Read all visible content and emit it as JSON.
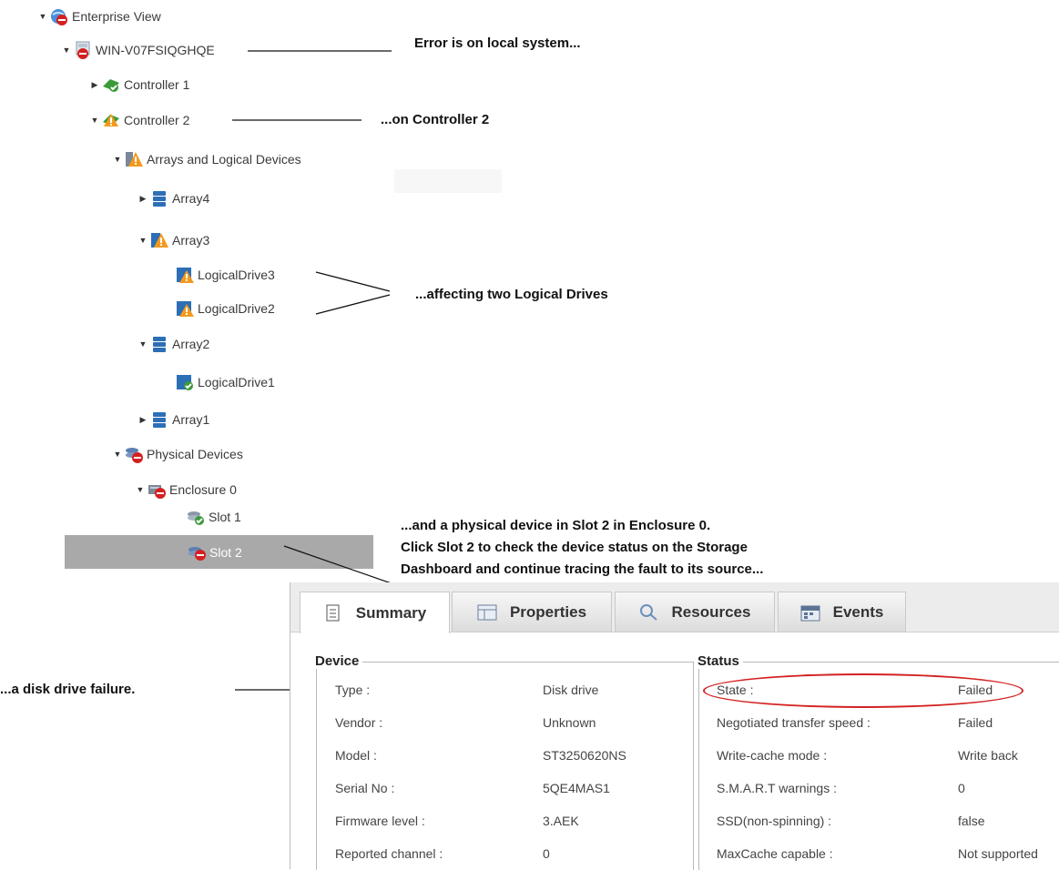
{
  "tree": [
    {
      "label": "Enterprise View",
      "caret": "▼",
      "icon": "globe-error-icon"
    },
    {
      "label": "WIN-V07FSIQGHQE",
      "caret": "▼",
      "icon": "system-error-icon"
    },
    {
      "label": "Controller 1",
      "caret": "▶",
      "icon": "controller-ok-icon"
    },
    {
      "label": "Controller 2",
      "caret": "▼",
      "icon": "controller-warning-icon"
    },
    {
      "label": "Arrays and Logical Devices",
      "caret": "▼",
      "icon": "arrays-warning-icon"
    },
    {
      "label": "Array4",
      "caret": "▶",
      "icon": "array-icon"
    },
    {
      "label": "Array3",
      "caret": "▼",
      "icon": "array-warning-icon"
    },
    {
      "label": "LogicalDrive3",
      "caret": "",
      "icon": "logical-drive-warning-icon"
    },
    {
      "label": "LogicalDrive2",
      "caret": "",
      "icon": "logical-drive-warning-icon"
    },
    {
      "label": "Array2",
      "caret": "▼",
      "icon": "array-icon"
    },
    {
      "label": "LogicalDrive1",
      "caret": "",
      "icon": "logical-drive-ok-icon"
    },
    {
      "label": "Array1",
      "caret": "▶",
      "icon": "array-icon"
    },
    {
      "label": "Physical Devices",
      "caret": "▼",
      "icon": "physical-devices-error-icon"
    },
    {
      "label": "Enclosure 0",
      "caret": "▼",
      "icon": "enclosure-error-icon"
    },
    {
      "label": "Slot 1",
      "caret": "",
      "icon": "disk-ok-icon"
    },
    {
      "label": "Slot 2",
      "caret": "",
      "icon": "disk-error-icon"
    }
  ],
  "callouts": {
    "local_system": "Error is on local system...",
    "controller2": "...on Controller 2",
    "logical_drives": "...affecting two Logical Drives",
    "physical_line1": "...and a physical device in Slot 2 in Enclosure 0.",
    "physical_line2": "Click Slot 2 to check the device status on the Storage",
    "physical_line3": "Dashboard and continue tracing the fault to its source...",
    "disk_failure": "...a disk drive failure."
  },
  "tabs": [
    {
      "label": "Summary",
      "icon": "document-icon",
      "active": true
    },
    {
      "label": "Properties",
      "icon": "properties-icon",
      "active": false
    },
    {
      "label": "Resources",
      "icon": "search-icon",
      "active": false
    },
    {
      "label": "Events",
      "icon": "calendar-icon",
      "active": false
    }
  ],
  "device": {
    "legend": "Device",
    "rows": [
      {
        "key": "Type :",
        "value": "Disk drive"
      },
      {
        "key": "Vendor :",
        "value": "Unknown"
      },
      {
        "key": "Model :",
        "value": "ST3250620NS"
      },
      {
        "key": "Serial No :",
        "value": "5QE4MAS1"
      },
      {
        "key": "Firmware level :",
        "value": "3.AEK"
      },
      {
        "key": "Reported channel :",
        "value": "0"
      }
    ]
  },
  "status": {
    "legend": "Status",
    "rows": [
      {
        "key": "State :",
        "value": "Failed"
      },
      {
        "key": "Negotiated transfer speed :",
        "value": "Failed"
      },
      {
        "key": "Write-cache mode :",
        "value": "Write back"
      },
      {
        "key": "S.M.A.R.T warnings :",
        "value": "0"
      },
      {
        "key": "SSD(non-spinning) :",
        "value": "false"
      },
      {
        "key": "MaxCache capable :",
        "value": "Not supported"
      }
    ]
  },
  "colors": {
    "error_red": "#d42020",
    "warning_orange": "#f39a1e",
    "ok_green": "#3a9a3a",
    "array_blue": "#2d6fb6",
    "selected_gray": "#a9a9a9"
  }
}
